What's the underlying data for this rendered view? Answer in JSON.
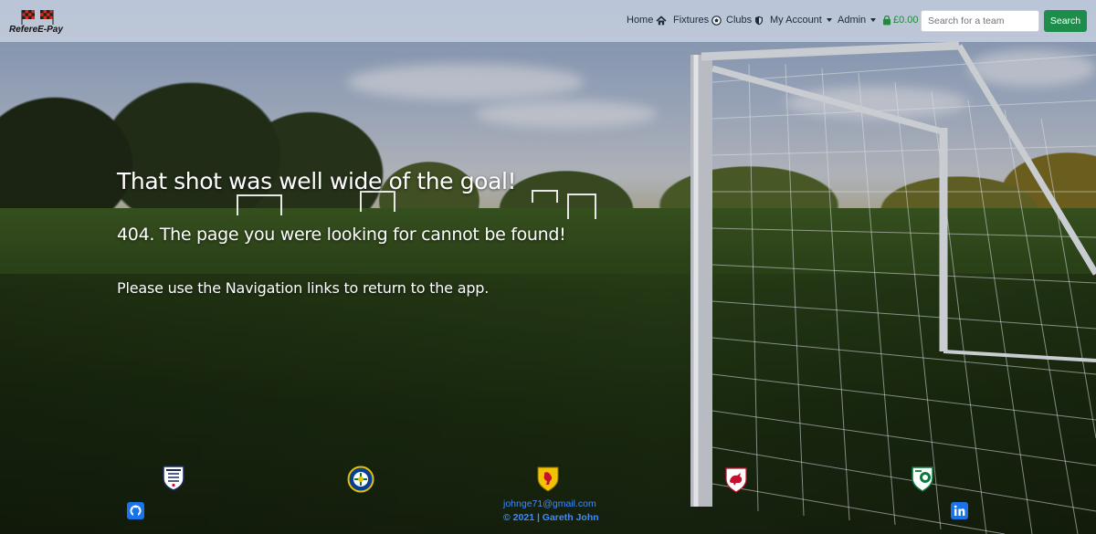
{
  "brand": {
    "name": "RefereE-Pay"
  },
  "nav": {
    "home": "Home",
    "fixtures": "Fixtures",
    "clubs": "Clubs",
    "my_account": "My Account",
    "admin": "Admin",
    "basket_total": "£0.00"
  },
  "search": {
    "placeholder": "Search for a team",
    "button_label": "Search"
  },
  "error": {
    "heading": "That shot was well wide of the goal!",
    "subheading": "404. The page you were looking for cannot be found!",
    "message": "Please use the Navigation links to return to the app."
  },
  "footer": {
    "email": "johnge71@gmail.com",
    "copyright_symbol": "©",
    "copyright_text": "2021 | Gareth John",
    "crests": [
      "england-crest",
      "northern-ireland-crest",
      "scotland-crest",
      "wales-crest",
      "ireland-crest"
    ],
    "social": [
      "github-icon",
      "linkedin-icon"
    ]
  },
  "colors": {
    "navbar_bg": "#d1d9e8",
    "search_button": "#1e8c4a",
    "basket": "#1f8a3a",
    "footer_link": "#3d8bff"
  },
  "icons": {
    "home": "home-icon",
    "fixtures": "football-icon",
    "clubs": "shield-icon",
    "basket": "shopping-basket-icon",
    "dropdown": "caret-down-icon"
  }
}
